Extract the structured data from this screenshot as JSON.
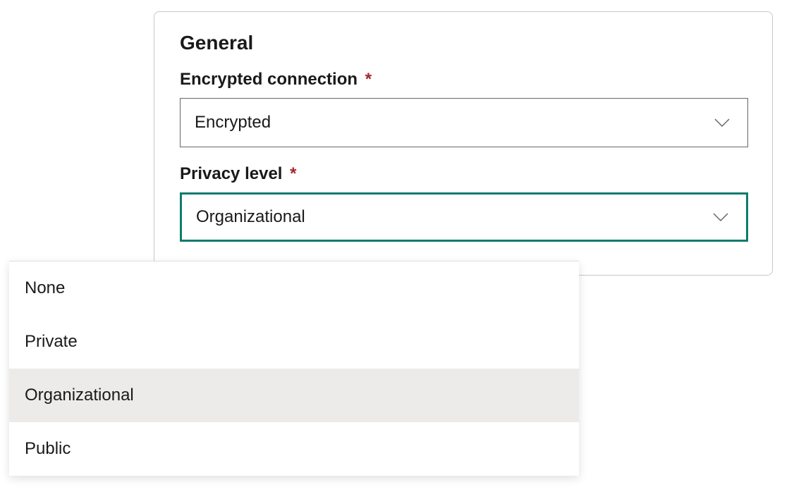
{
  "panel": {
    "section_title": "General",
    "encrypted_connection": {
      "label": "Encrypted connection",
      "required_marker": "*",
      "value": "Encrypted"
    },
    "privacy_level": {
      "label": "Privacy level",
      "required_marker": "*",
      "value": "Organizational",
      "options": [
        "None",
        "Private",
        "Organizational",
        "Public"
      ],
      "selected_index": 2
    }
  }
}
